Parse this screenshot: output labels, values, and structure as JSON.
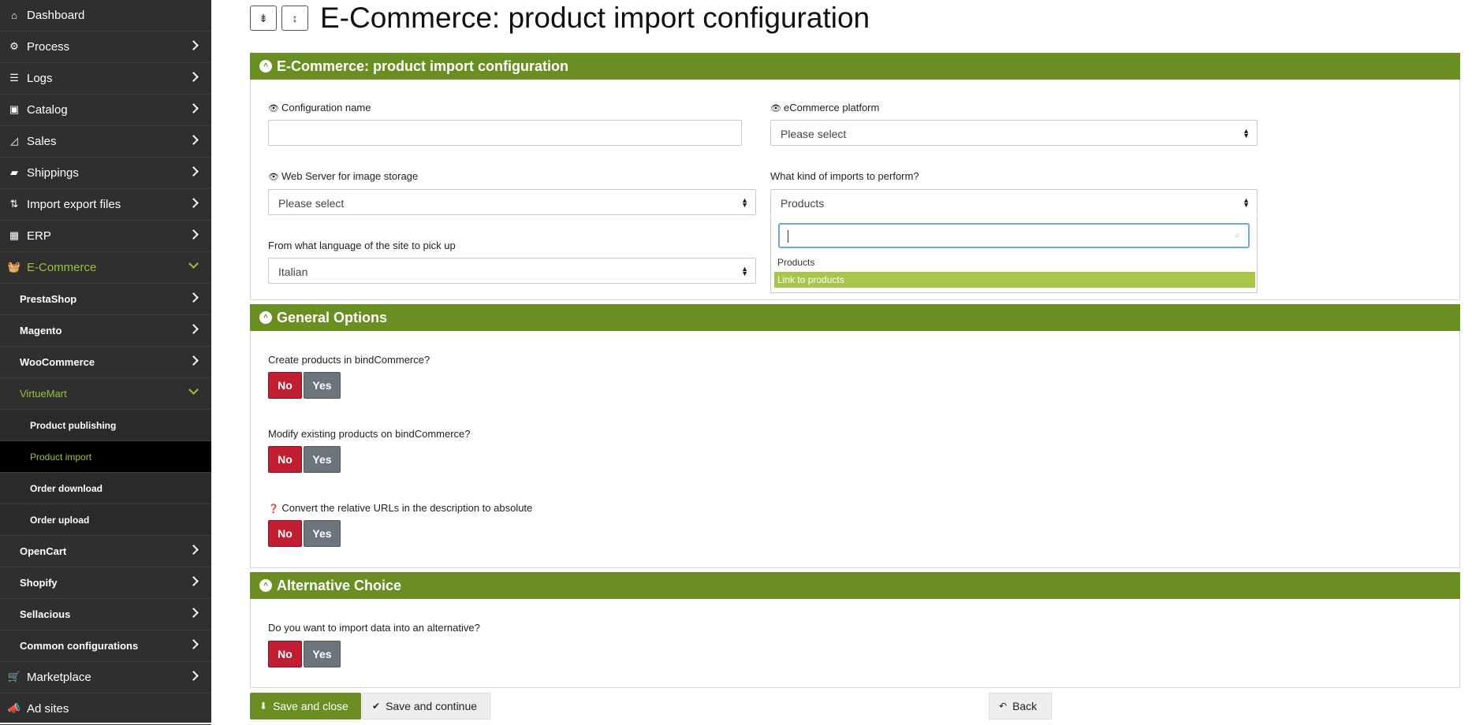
{
  "sidebar": {
    "items": [
      {
        "label": "Dashboard",
        "icon": "home-icon"
      },
      {
        "label": "Process",
        "icon": "process-icon"
      },
      {
        "label": "Logs",
        "icon": "logs-icon"
      },
      {
        "label": "Catalog",
        "icon": "cube-icon"
      },
      {
        "label": "Sales",
        "icon": "chart-icon"
      },
      {
        "label": "Shippings",
        "icon": "truck-icon"
      },
      {
        "label": "Import export files",
        "icon": "sort-icon"
      },
      {
        "label": "ERP",
        "icon": "building-icon"
      },
      {
        "label": "E-Commerce",
        "icon": "basket-icon"
      }
    ],
    "ecommerce_children": [
      {
        "label": "PrestaShop"
      },
      {
        "label": "Magento"
      },
      {
        "label": "WooCommerce"
      },
      {
        "label": "VirtueMart"
      }
    ],
    "virtuemart_children": [
      {
        "label": "Product publishing"
      },
      {
        "label": "Product import"
      },
      {
        "label": "Order download"
      },
      {
        "label": "Order upload"
      }
    ],
    "more_children": [
      {
        "label": "OpenCart"
      },
      {
        "label": "Shopify"
      },
      {
        "label": "Sellacious"
      },
      {
        "label": "Common configurations"
      }
    ],
    "bottom_items": [
      {
        "label": "Marketplace",
        "icon": "cart-icon"
      },
      {
        "label": "Ad sites",
        "icon": "megaphone-icon"
      }
    ]
  },
  "page": {
    "title": "E-Commerce: product import configuration"
  },
  "config_panel": {
    "heading": "E-Commerce: product import configuration",
    "config_name_label": "Configuration name",
    "config_name_value": "",
    "platform_label": "eCommerce platform",
    "platform_value": "Please select",
    "webserver_label": "Web Server for image storage",
    "webserver_value": "Please select",
    "imports_label": "What kind of imports to perform?",
    "imports_value": "Products",
    "language_label": "From what language of the site to pick up",
    "language_value": "Italian",
    "dropdown_options": [
      "Products",
      "Link to products"
    ]
  },
  "general_panel": {
    "heading": "General Options",
    "q1": "Create products in bindCommerce?",
    "q2": "Modify existing products on bindCommerce?",
    "q3": "Convert the relative URLs in the description to absolute",
    "no_label": "No",
    "yes_label": "Yes"
  },
  "alt_panel": {
    "heading": "Alternative Choice",
    "q1": "Do you want to import data into an alternative?"
  },
  "footer": {
    "save_close": "Save and close",
    "save_continue": "Save and continue",
    "back": "Back"
  },
  "colors": {
    "sidebar_bg": "#2f2f2f",
    "accent_green": "#6b8e23",
    "active_green": "#9bc33b",
    "highlight_green": "#a8c64a",
    "no_red": "#c01f33",
    "yes_gray": "#6c757d"
  }
}
